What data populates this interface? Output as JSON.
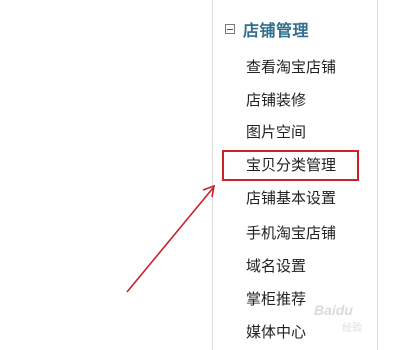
{
  "sidebar": {
    "group_title": "店铺管理",
    "items": [
      {
        "label": "查看淘宝店铺"
      },
      {
        "label": "店铺装修"
      },
      {
        "label": "图片空间"
      },
      {
        "label": "宝贝分类管理"
      },
      {
        "label": "店铺基本设置"
      },
      {
        "label": "手机淘宝店铺"
      },
      {
        "label": "域名设置"
      },
      {
        "label": "掌柜推荐"
      },
      {
        "label": "媒体中心"
      }
    ],
    "highlighted_item_index": 3
  },
  "annotation": {
    "arrow_color": "#c6232a",
    "box_color": "#c6232a"
  },
  "colors": {
    "group_title": "#2f6f8f",
    "item_text": "#222222",
    "border": "#dcdcdc"
  }
}
